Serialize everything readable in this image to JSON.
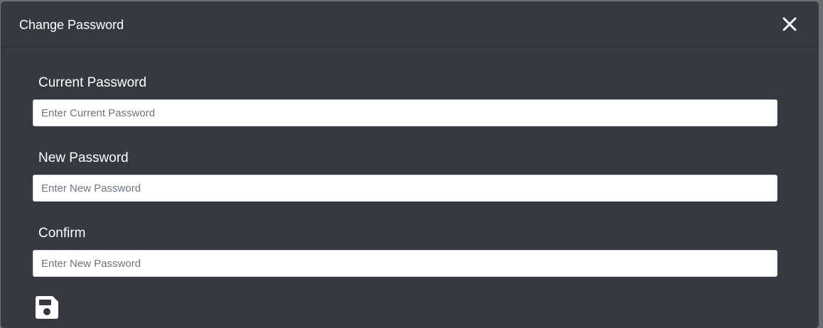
{
  "dialog": {
    "title": "Change Password",
    "close_icon": "close-icon"
  },
  "form": {
    "fields": [
      {
        "label": "Current Password",
        "placeholder": "Enter Current Password",
        "value": ""
      },
      {
        "label": "New Password",
        "placeholder": "Enter New Password",
        "value": ""
      },
      {
        "label": "Confirm",
        "placeholder": "Enter New Password",
        "value": ""
      }
    ],
    "save_icon": "floppy-disk-icon"
  },
  "colors": {
    "modal_background": "#343a40",
    "backdrop": "#6b6e73",
    "text": "#ffffff",
    "input_background": "#ffffff",
    "placeholder": "#6c757d"
  }
}
